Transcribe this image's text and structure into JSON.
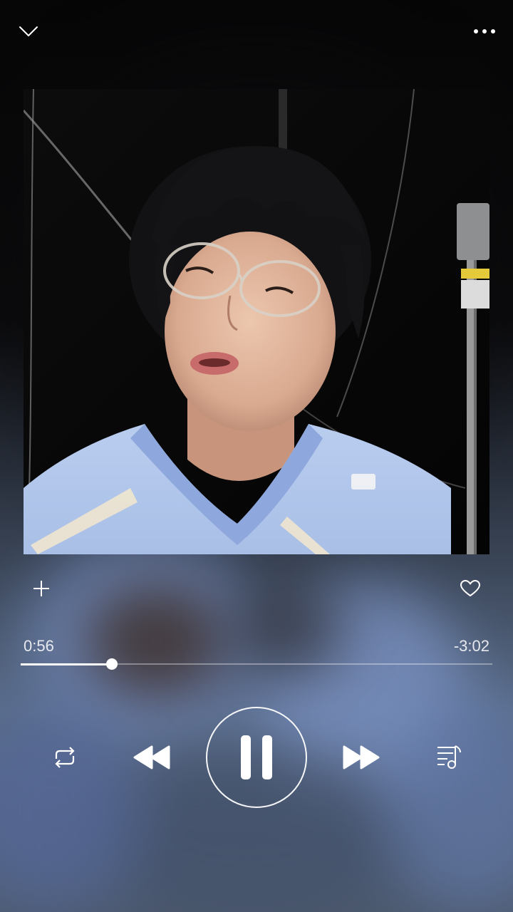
{
  "player": {
    "elapsed": "0:56",
    "remaining": "-3:02",
    "progress": 0.193,
    "state": "playing"
  },
  "icons": {
    "collapse": "chevron-down-icon",
    "more": "more-dots-icon",
    "add": "plus-icon",
    "favorite": "heart-outline-icon",
    "repeat": "repeat-icon",
    "previous": "previous-track-icon",
    "pause": "pause-icon",
    "next": "next-track-icon",
    "queue": "playlist-icon"
  },
  "colors": {
    "accent": "#ffffff",
    "track": "#8a8f99"
  }
}
